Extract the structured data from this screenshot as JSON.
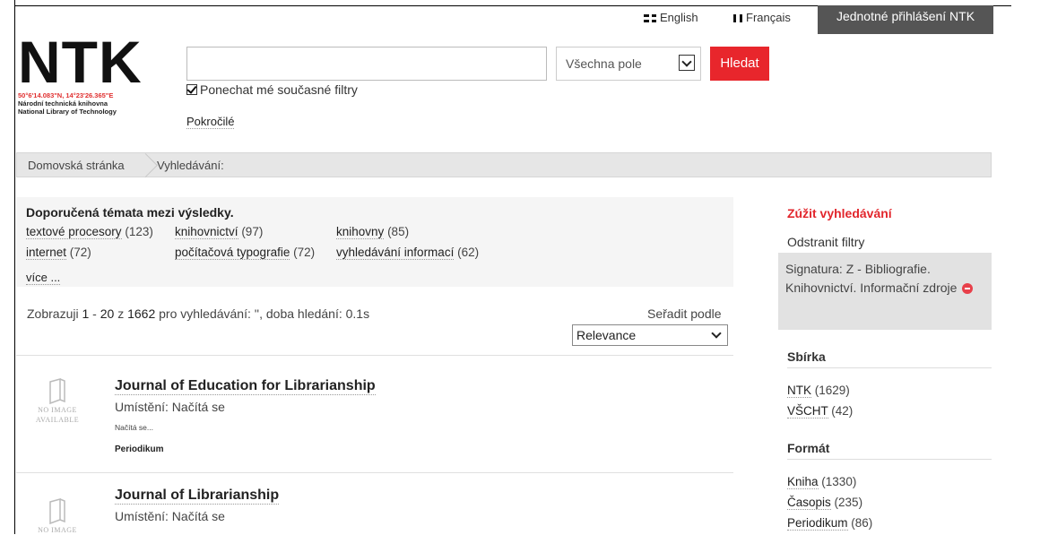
{
  "header": {
    "lang_en": "English",
    "lang_fr": "Français",
    "sso_button": "Jednotné přihlášení NTK"
  },
  "logo": {
    "title": "NTK",
    "coords": "50°6'14.083\"N, 14°23'26.365\"E",
    "line1": "Národní technická knihovna",
    "line2": "National Library of Technology"
  },
  "search": {
    "query": "",
    "field_select": "Všechna pole",
    "submit": "Hledat",
    "keep_filters": "Ponechat mé současné filtry",
    "advanced": "Pokročilé"
  },
  "breadcrumb": {
    "home": "Domovská stránka",
    "current": "Vyhledávání:"
  },
  "topics": {
    "title": "Doporučená témata mezi výsledky.",
    "items": [
      {
        "label": "textové procesory",
        "count": "(123)"
      },
      {
        "label": "knihovnictví",
        "count": "(97)"
      },
      {
        "label": "knihovny",
        "count": "(85)"
      },
      {
        "label": "internet",
        "count": "(72)"
      },
      {
        "label": "počítačová typografie",
        "count": "(72)"
      },
      {
        "label": "vyhledávání informací",
        "count": "(62)"
      }
    ],
    "more": "více ..."
  },
  "results_info": {
    "prefix": "Zobrazuji",
    "from": "1",
    "dash": "-",
    "to": "20",
    "of": "z",
    "total": "1662",
    "suffix": "pro vyhledávání: '', doba hledání: 0.1s"
  },
  "sort": {
    "label": "Seřadit podle",
    "value": "Relevance"
  },
  "no_image": {
    "line1": "NO IMAGE",
    "line2": "AVAILABLE"
  },
  "results": [
    {
      "title": "Journal of Education for Librarianship",
      "location_label": "Umístění:",
      "location_value": "Načítá se",
      "loading": "Načítá se...",
      "format": "Periodikum"
    },
    {
      "title": "Journal of Librarianship",
      "location_label": "Umístění:",
      "location_value": "Načítá se"
    }
  ],
  "sidebar": {
    "narrow_title": "Zúžit vyhledávání",
    "remove_filters": "Odstranit filtry",
    "active_filter": "Signatura: Z - Bibliografie. Knihovnictví. Informační zdroje",
    "collection_title": "Sbírka",
    "collection": [
      {
        "label": "NTK",
        "count": "(1629)"
      },
      {
        "label": "VŠCHT",
        "count": "(42)"
      }
    ],
    "format_title": "Formát",
    "formats": [
      {
        "label": "Kniha",
        "count": "(1330)"
      },
      {
        "label": "Časopis",
        "count": "(235)"
      },
      {
        "label": "Periodikum",
        "count": "(86)"
      }
    ]
  },
  "colors": {
    "accent_red": "#e8262c",
    "sso_bg": "#555555",
    "breadcrumb_bg": "#e6e6e6"
  }
}
